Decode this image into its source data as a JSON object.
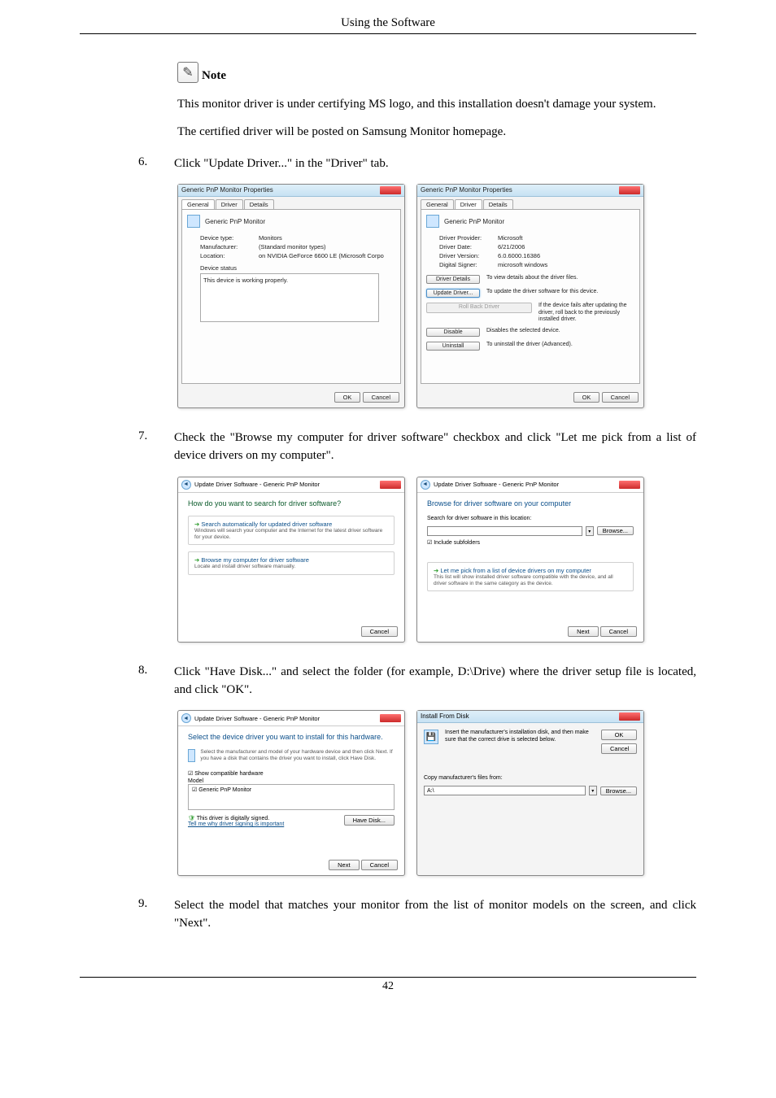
{
  "header": {
    "title": "Using the Software"
  },
  "note": {
    "label": "Note",
    "p1": "This monitor driver is under certifying MS logo, and this installation doesn't damage your system.",
    "p2": "The certified driver will be posted on Samsung Monitor homepage."
  },
  "steps": {
    "6": {
      "num": "6.",
      "text": "Click \"Update Driver...\" in the \"Driver\" tab."
    },
    "7": {
      "num": "7.",
      "text": "Check the \"Browse my computer for driver software\" checkbox and click \"Let me pick from a list of device drivers on my computer\"."
    },
    "8": {
      "num": "8.",
      "text": "Click \"Have Disk...\" and select the folder (for example, D:\\Drive) where the driver setup file is located, and click \"OK\"."
    },
    "9": {
      "num": "9.",
      "text": "Select the model that matches your monitor from the list of monitor models on the screen, and click \"Next\"."
    }
  },
  "props_general": {
    "title": "Generic PnP Monitor Properties",
    "tabs": {
      "general": "General",
      "driver": "Driver",
      "details": "Details"
    },
    "name": "Generic PnP Monitor",
    "dev_type_k": "Device type:",
    "dev_type_v": "Monitors",
    "manu_k": "Manufacturer:",
    "manu_v": "(Standard monitor types)",
    "loc_k": "Location:",
    "loc_v": "on NVIDIA GeForce 6600 LE (Microsoft Corpo",
    "status_label": "Device status",
    "status_text": "This device is working properly.",
    "ok": "OK",
    "cancel": "Cancel"
  },
  "props_driver": {
    "title": "Generic PnP Monitor Properties",
    "name": "Generic PnP Monitor",
    "provider_k": "Driver Provider:",
    "provider_v": "Microsoft",
    "date_k": "Driver Date:",
    "date_v": "6/21/2006",
    "ver_k": "Driver Version:",
    "ver_v": "6.0.6000.16386",
    "signer_k": "Digital Signer:",
    "signer_v": "microsoft windows",
    "b_details": "Driver Details",
    "b_details_d": "To view details about the driver files.",
    "b_update": "Update Driver...",
    "b_update_d": "To update the driver software for this device.",
    "b_rollback": "Roll Back Driver",
    "b_rollback_d": "If the device fails after updating the driver, roll back to the previously installed driver.",
    "b_disable": "Disable",
    "b_disable_d": "Disables the selected device.",
    "b_uninstall": "Uninstall",
    "b_uninstall_d": "To uninstall the driver (Advanced).",
    "ok": "OK",
    "cancel": "Cancel"
  },
  "wiz_search": {
    "crumb": "Update Driver Software - Generic PnP Monitor",
    "h": "How do you want to search for driver software?",
    "opt1_t": "Search automatically for updated driver software",
    "opt1_s": "Windows will search your computer and the Internet for the latest driver software for your device.",
    "opt2_t": "Browse my computer for driver software",
    "opt2_s": "Locate and install driver software manually.",
    "cancel": "Cancel"
  },
  "wiz_browse": {
    "crumb": "Update Driver Software - Generic PnP Monitor",
    "h": "Browse for driver software on your computer",
    "loc_label": "Search for driver software in this location:",
    "browse": "Browse...",
    "chk": "Include subfolders",
    "opt_t": "Let me pick from a list of device drivers on my computer",
    "opt_s": "This list will show installed driver software compatible with the device, and all driver software in the same category as the device.",
    "next": "Next",
    "cancel": "Cancel"
  },
  "wiz_select": {
    "crumb": "Update Driver Software - Generic PnP Monitor",
    "h": "Select the device driver you want to install for this hardware.",
    "s": "Select the manufacturer and model of your hardware device and then click Next. If you have a disk that contains the driver you want to install, click Have Disk.",
    "chk": "Show compatible hardware",
    "model_label": "Model",
    "model": "Generic PnP Monitor",
    "signed": "This driver is digitally signed.",
    "tell": "Tell me why driver signing is important",
    "have_disk": "Have Disk...",
    "next": "Next",
    "cancel": "Cancel"
  },
  "disk": {
    "title": "Install From Disk",
    "msg": "Insert the manufacturer's installation disk, and then make sure that the correct drive is selected below.",
    "ok": "OK",
    "cancel": "Cancel",
    "copy_label": "Copy manufacturer's files from:",
    "path": "A:\\",
    "browse": "Browse..."
  },
  "footer": {
    "page": "42"
  }
}
